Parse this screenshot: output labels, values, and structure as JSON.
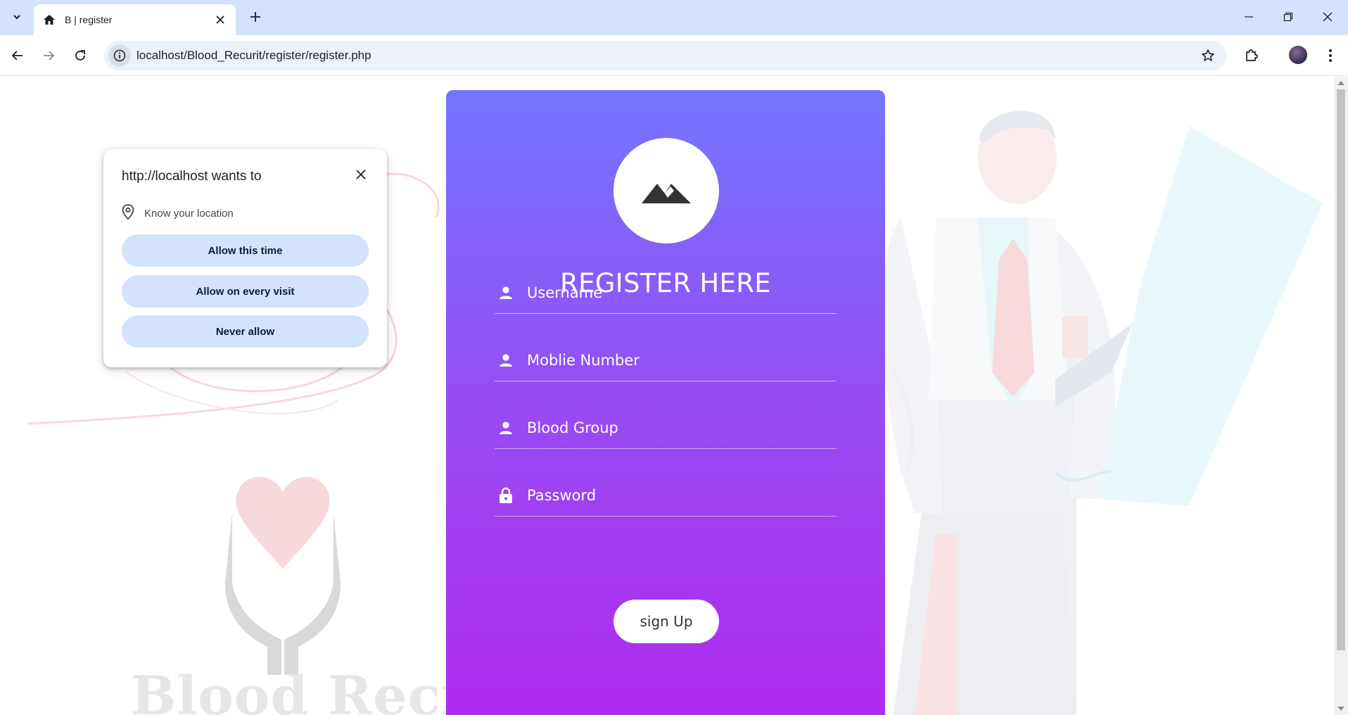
{
  "browser": {
    "tab_title": "B | register",
    "url": "localhost/Blood_Recurit/register/register.php"
  },
  "permission_prompt": {
    "title": "http://localhost wants to",
    "permission": "Know your location",
    "buttons": [
      "Allow this time",
      "Allow on every visit",
      "Never allow"
    ]
  },
  "form": {
    "title": "REGISTER HERE",
    "fields": [
      {
        "placeholder": "Username",
        "icon": "user-icon"
      },
      {
        "placeholder": "Moblie Number",
        "icon": "user-icon"
      },
      {
        "placeholder": "Blood Group",
        "icon": "user-icon"
      },
      {
        "placeholder": "Password",
        "icon": "lock-icon"
      }
    ],
    "submit_label": "sign Up"
  },
  "background": {
    "logo_text": "Blood Recru"
  },
  "colors": {
    "card_gradient_top": "#7475ff",
    "card_gradient_bottom": "#b029ef",
    "tabbar": "#d3e3fd",
    "prompt_button": "#d3e3fd"
  }
}
